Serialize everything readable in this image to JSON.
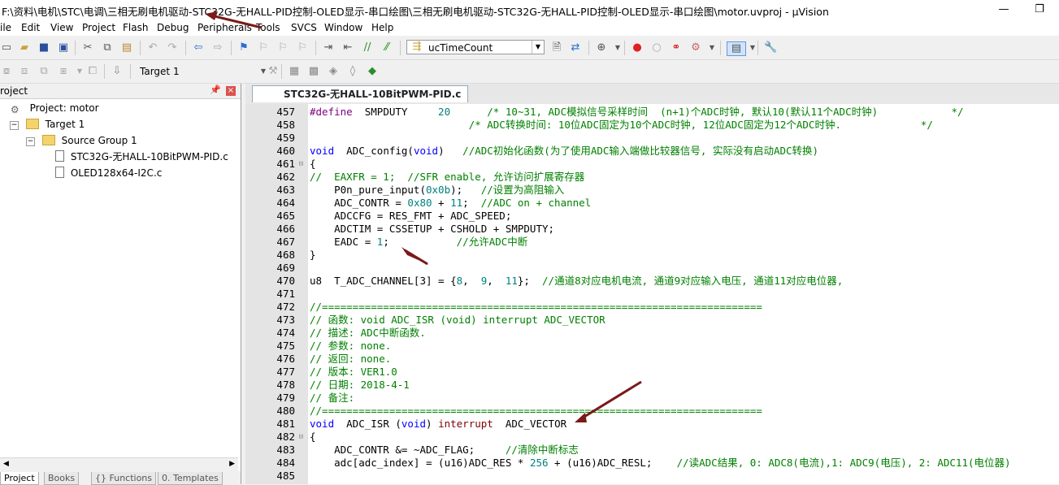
{
  "window": {
    "title": "F:\\资料\\电机\\STC\\电调\\三相无刷电机驱动-STC32G-无HALL-PID控制-OLED显示-串口绘图\\三相无刷电机驱动-STC32G-无HALL-PID控制-OLED显示-串口绘图\\motor.uvproj - µVision",
    "controls": [
      "—",
      "❐"
    ]
  },
  "menu": [
    "ile",
    "Edit",
    "View",
    "Project",
    "Flash",
    "Debug",
    "Peripherals",
    "Tools",
    "SVCS",
    "Window",
    "Help"
  ],
  "toolbar": {
    "find_value": "ucTimeCount",
    "target": "Target 1"
  },
  "project_panel": {
    "title": "roject",
    "tree": [
      {
        "label": "Project: motor"
      },
      {
        "label": "Target 1"
      },
      {
        "label": "Source Group 1"
      },
      {
        "label": "STC32G-无HALL-10BitPWM-PID.c"
      },
      {
        "label": "OLED128x64-I2C.c"
      }
    ],
    "tabs": [
      "Project",
      "Books",
      "{} Functions",
      "0. Templates"
    ]
  },
  "editor": {
    "tab": "STC32G-无HALL-10BitPWM-PID.c",
    "lines": [
      {
        "n": "457",
        "segs": [
          [
            "pp",
            "#define"
          ],
          [
            "",
            "  SMPDUTY     "
          ],
          [
            "nm",
            "20"
          ],
          [
            "",
            "      "
          ],
          [
            "cm",
            "/* 10~31, ADC模拟信号采样时间  (n+1)个ADC时钟, 默认10(默认11个ADC时钟)            */"
          ]
        ]
      },
      {
        "n": "458",
        "segs": [
          [
            "",
            "                          "
          ],
          [
            "cm",
            "/* ADC转换时间: 10位ADC固定为10个ADC时钟, 12位ADC固定为12个ADC时钟.             */"
          ]
        ]
      },
      {
        "n": "459",
        "segs": []
      },
      {
        "n": "460",
        "segs": [
          [
            "kw",
            "void"
          ],
          [
            "",
            "  ADC_config("
          ],
          [
            "kw",
            "void"
          ],
          [
            "",
            ")   "
          ],
          [
            "cm",
            "//ADC初始化函数(为了使用ADC输入端做比较器信号, 实际没有启动ADC转换)"
          ]
        ]
      },
      {
        "n": "461",
        "fold": "⊟",
        "segs": [
          [
            "",
            "{"
          ]
        ]
      },
      {
        "n": "462",
        "segs": [
          [
            "cm",
            "//  EAXFR = 1;  //SFR enable, 允许访问扩展寄存器"
          ]
        ]
      },
      {
        "n": "463",
        "segs": [
          [
            "",
            "    P0n_pure_input("
          ],
          [
            "nm",
            "0x0b"
          ],
          [
            "",
            ");   "
          ],
          [
            "cm",
            "//设置为高阻输入"
          ]
        ]
      },
      {
        "n": "464",
        "segs": [
          [
            "",
            "    ADC_CONTR = "
          ],
          [
            "nm",
            "0x80"
          ],
          [
            "",
            " + "
          ],
          [
            "nm",
            "11"
          ],
          [
            "",
            ";  "
          ],
          [
            "cm",
            "//ADC on + channel"
          ]
        ]
      },
      {
        "n": "465",
        "segs": [
          [
            "",
            "    ADCCFG = RES_FMT + ADC_SPEED;"
          ]
        ]
      },
      {
        "n": "466",
        "segs": [
          [
            "",
            "    ADCTIM = CSSETUP + CSHOLD + SMPDUTY;"
          ]
        ]
      },
      {
        "n": "467",
        "segs": [
          [
            "",
            "    EADC = "
          ],
          [
            "nm",
            "1"
          ],
          [
            "",
            ";           "
          ],
          [
            "cm",
            "//允许ADC中断"
          ]
        ]
      },
      {
        "n": "468",
        "segs": [
          [
            "",
            "}"
          ]
        ]
      },
      {
        "n": "469",
        "segs": []
      },
      {
        "n": "470",
        "segs": [
          [
            "",
            "u8  T_ADC_CHANNEL[3] = {"
          ],
          [
            "nm",
            "8"
          ],
          [
            "",
            ",  "
          ],
          [
            "nm",
            "9"
          ],
          [
            "",
            ",  "
          ],
          [
            "nm",
            "11"
          ],
          [
            "",
            "};  "
          ],
          [
            "cm",
            "//通道8对应电机电流, 通道9对应输入电压, 通道11对应电位器,"
          ]
        ]
      },
      {
        "n": "471",
        "segs": []
      },
      {
        "n": "472",
        "segs": [
          [
            "cm",
            "//========================================================================"
          ]
        ]
      },
      {
        "n": "473",
        "segs": [
          [
            "cm",
            "// 函数: void ADC_ISR (void) interrupt ADC_VECTOR"
          ]
        ]
      },
      {
        "n": "474",
        "segs": [
          [
            "cm",
            "// 描述: ADC中断函数."
          ]
        ]
      },
      {
        "n": "475",
        "segs": [
          [
            "cm",
            "// 参数: none."
          ]
        ]
      },
      {
        "n": "476",
        "segs": [
          [
            "cm",
            "// 返回: none."
          ]
        ]
      },
      {
        "n": "477",
        "segs": [
          [
            "cm",
            "// 版本: VER1.0"
          ]
        ]
      },
      {
        "n": "478",
        "segs": [
          [
            "cm",
            "// 日期: 2018-4-1"
          ]
        ]
      },
      {
        "n": "479",
        "segs": [
          [
            "cm",
            "// 备注:"
          ]
        ]
      },
      {
        "n": "480",
        "segs": [
          [
            "cm",
            "//========================================================================"
          ]
        ]
      },
      {
        "n": "481",
        "segs": [
          [
            "kw",
            "void"
          ],
          [
            "",
            "  ADC_ISR ("
          ],
          [
            "kw",
            "void"
          ],
          [
            "",
            ") "
          ],
          [
            "ir",
            "interrupt"
          ],
          [
            "",
            "  ADC_VECTOR"
          ]
        ]
      },
      {
        "n": "482",
        "fold": "⊟",
        "segs": [
          [
            "",
            "{"
          ]
        ]
      },
      {
        "n": "483",
        "segs": [
          [
            "",
            "    ADC_CONTR &= ~ADC_FLAG;     "
          ],
          [
            "cm",
            "//清除中断标志"
          ]
        ]
      },
      {
        "n": "484",
        "segs": [
          [
            "",
            "    adc[adc_index] = (u16)ADC_RES * "
          ],
          [
            "nm",
            "256"
          ],
          [
            "",
            " + (u16)ADC_RESL;    "
          ],
          [
            "cm",
            "//读ADC结果, 0: ADC8(电流),1: ADC9(电压), 2: ADC11(电位器)"
          ]
        ]
      },
      {
        "n": "485",
        "segs": []
      }
    ]
  }
}
